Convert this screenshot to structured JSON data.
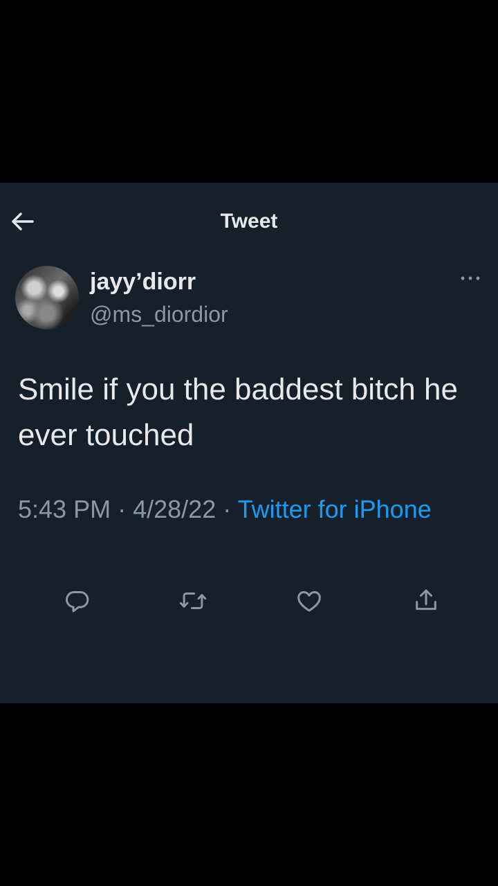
{
  "header": {
    "title": "Tweet",
    "back_icon": "arrow-left-icon"
  },
  "author": {
    "display_name": "jayy’diorr",
    "handle": "@ms_diordior",
    "more_icon": "more-horizontal-icon"
  },
  "tweet": {
    "text": "Smile if you the baddest bitch he ever touched",
    "time": "5:43 PM",
    "separator": "·",
    "date": "4/28/22",
    "source": "Twitter for iPhone"
  },
  "actions": [
    {
      "icon": "reply-icon"
    },
    {
      "icon": "retweet-icon"
    },
    {
      "icon": "like-icon"
    },
    {
      "icon": "share-icon"
    }
  ],
  "colors": {
    "panel_background": "#15202b",
    "page_background": "#000000",
    "primary_text": "#e7e9ea",
    "secondary_text": "#8b98a5",
    "accent": "#1d9bf0"
  }
}
